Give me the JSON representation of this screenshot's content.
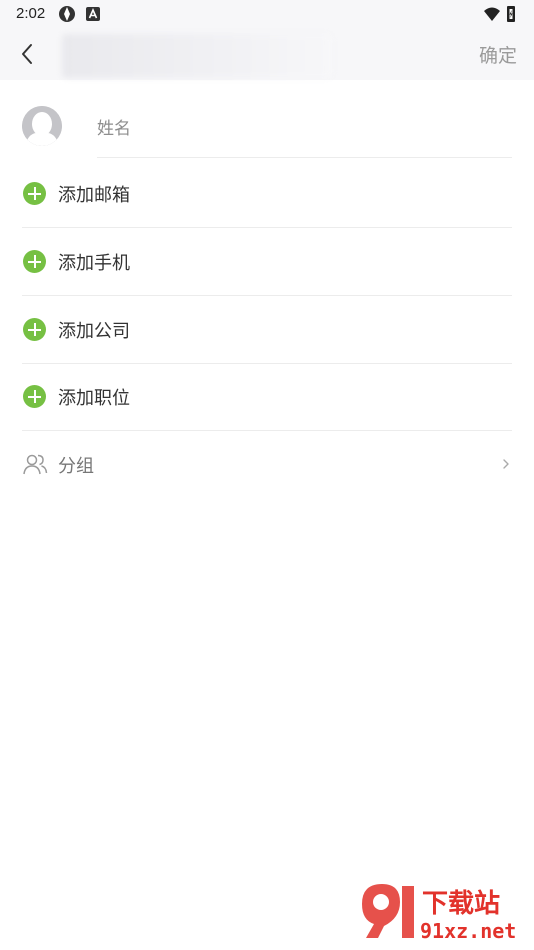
{
  "status_bar": {
    "time": "2:02"
  },
  "header": {
    "confirm_label": "确定"
  },
  "name_field": {
    "placeholder": "姓名"
  },
  "rows": [
    {
      "label": "添加邮箱",
      "icon": "plus-circle-icon"
    },
    {
      "label": "添加手机",
      "icon": "plus-circle-icon"
    },
    {
      "label": "添加公司",
      "icon": "plus-circle-icon"
    },
    {
      "label": "添加职位",
      "icon": "plus-circle-icon"
    }
  ],
  "group_row": {
    "label": "分组",
    "icon": "group-users-icon"
  },
  "watermark": {
    "brand_cn": "下载站",
    "brand_url": "91xz.net"
  },
  "colors": {
    "accent_green": "#76c043",
    "header_bg": "#f7f7f9",
    "confirm_text": "#9a9a9a",
    "watermark_red": "#e2322b"
  }
}
